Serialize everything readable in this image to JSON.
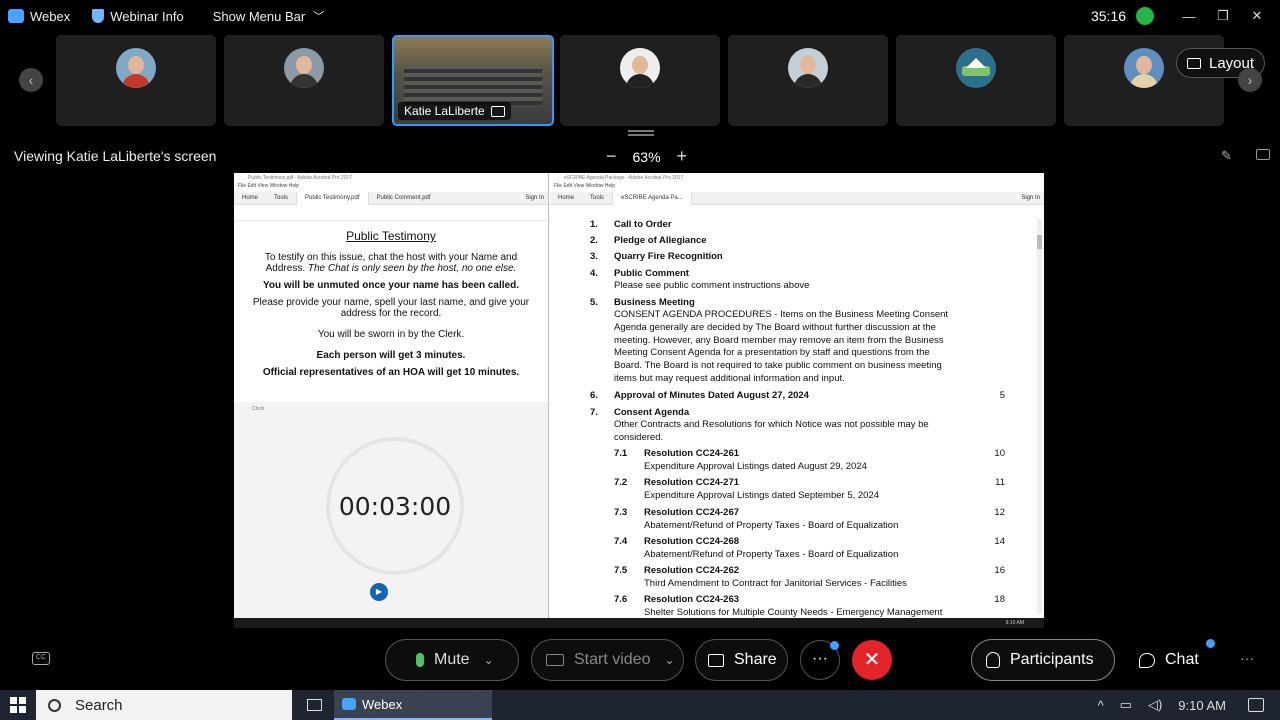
{
  "topbar": {
    "app_name": "Webex",
    "webinar_info": "Webinar Info",
    "show_menu_bar": "Show Menu Bar",
    "timer": "35:16",
    "minimize": "—",
    "restore": "❐",
    "close": "✕"
  },
  "filmstrip": {
    "active_name": "Katie LaLiberte",
    "layout_label": "Layout",
    "prev_arrow": "‹",
    "next_arrow": "›"
  },
  "share": {
    "viewing_text": "Viewing Katie LaLiberte's screen",
    "zoom_level": "63%",
    "zoom_out": "−",
    "zoom_in": "+"
  },
  "left_app": {
    "title": "Public Testimony.pdf - Adobe Acrobat Pro 2017",
    "menu": "File  Edit  View  Window  Help",
    "tab_home": "Home",
    "tab_tools": "Tools",
    "tab_doc1": "Public Testimony.pdf",
    "tab_doc2": "Public Comment.pdf",
    "sign_in": "Sign In"
  },
  "testimony": {
    "title": "Public Testimony",
    "line1": "To testify on this issue, chat the host with your Name and Address.",
    "line1_italic": "The Chat is only seen by the host, no one else.",
    "line2": "You will be unmuted once your name has been called.",
    "line3": "Please provide your name, spell your last name, and give your address for the record.",
    "line4": "You will be sworn in by the Clerk.",
    "line5": "Each person will get 3 minutes.",
    "line6": "Official representatives of an HOA will get 10 minutes."
  },
  "clock": {
    "title": "Clock",
    "time": "00:03:00",
    "play": "▶"
  },
  "right_app": {
    "title": "eSCRIBE Agenda Package - Adobe Acrobat Pro 2017",
    "menu": "File  Edit  View  Window  Help",
    "tab_home": "Home",
    "tab_tools": "Tools",
    "tab_doc": "eSCRIBE Agenda Pa...",
    "sign_in": "Sign In"
  },
  "agenda": {
    "i1_num": "1.",
    "i1_title": "Call to Order",
    "i2_num": "2.",
    "i2_title": "Pledge of Allegiance",
    "i3_num": "3.",
    "i3_title": "Quarry Fire Recognition",
    "i4_num": "4.",
    "i4_title": "Public Comment",
    "i4_desc": "Please see public comment instructions above",
    "i5_num": "5.",
    "i5_title": "Business Meeting",
    "i5_desc": "CONSENT AGENDA PROCEDURES - Items on the Business Meeting Consent Agenda generally are decided by The Board without further discussion at the meeting.  However, any Board member may remove an item from the Business Meeting Consent Agenda for a presentation by staff and questions from the Board.  The Board is not required to take public comment on business meeting items but may request additional information and input.",
    "i6_num": "6.",
    "i6_title": "Approval of Minutes Dated August 27, 2024",
    "i6_page": "5",
    "i7_num": "7.",
    "i7_title": "Consent Agenda",
    "i7_desc": "Other Contracts and Resolutions for which Notice was not possible may be considered.",
    "s71_num": "7.1",
    "s71_title": "Resolution CC24-261",
    "s71_desc": "Expenditure Approval Listings dated August 29, 2024",
    "s71_page": "10",
    "s72_num": "7.2",
    "s72_title": "Resolution CC24-271",
    "s72_desc": "Expenditure Approval Listings dated September 5, 2024",
    "s72_page": "11",
    "s73_num": "7.3",
    "s73_title": "Resolution CC24-267",
    "s73_desc": "Abatement/Refund of Property Taxes - Board of Equalization",
    "s73_page": "12",
    "s74_num": "7.4",
    "s74_title": "Resolution CC24-268",
    "s74_desc": "Abatement/Refund of Property Taxes - Board of Equalization",
    "s74_page": "14",
    "s75_num": "7.5",
    "s75_title": "Resolution CC24-262",
    "s75_desc": "Third Amendment to Contract for Janitorial Services - Facilities",
    "s75_page": "16",
    "s76_num": "7.6",
    "s76_title": "Resolution CC24-263",
    "s76_desc": "Shelter Solutions for Multiple County Needs - Emergency Management",
    "s76_page": "18"
  },
  "shared_taskbar_time": "9:10 AM",
  "controls": {
    "mute": "Mute",
    "start_video": "Start video",
    "share": "Share",
    "more": "···",
    "leave": "✕",
    "participants": "Participants",
    "chat": "Chat",
    "more_right": "···",
    "cc": "CC",
    "chevron": "⌄"
  },
  "taskbar": {
    "search": "Search",
    "webex": "Webex",
    "time": "9:10 AM",
    "tray_up": "^"
  }
}
